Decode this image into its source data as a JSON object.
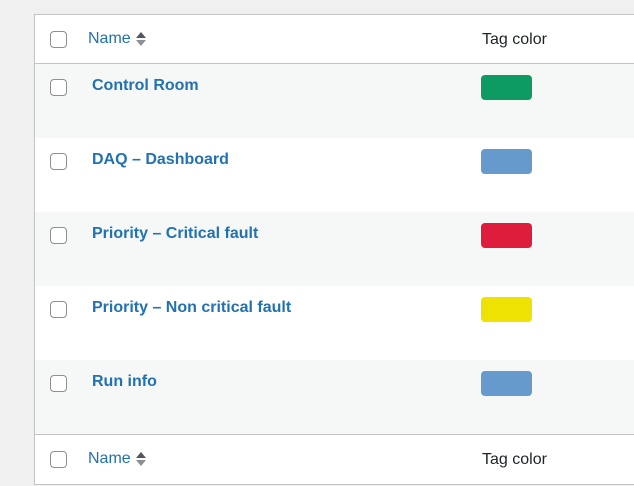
{
  "header": {
    "name_label": "Name",
    "tag_color_label": "Tag color"
  },
  "footer": {
    "name_label": "Name",
    "tag_color_label": "Tag color"
  },
  "rows": [
    {
      "name": "Control Room",
      "color": "#0e9b63"
    },
    {
      "name": "DAQ – Dashboard",
      "color": "#6699cc"
    },
    {
      "name": "Priority – Critical fault",
      "color": "#dd1d3b"
    },
    {
      "name": "Priority – Non critical fault",
      "color": "#eee202"
    },
    {
      "name": "Run info",
      "color": "#6699cc"
    }
  ],
  "colors": {
    "link": "#2271b1",
    "border": "#c3c4c7",
    "alt_row": "#f6f7f7"
  }
}
